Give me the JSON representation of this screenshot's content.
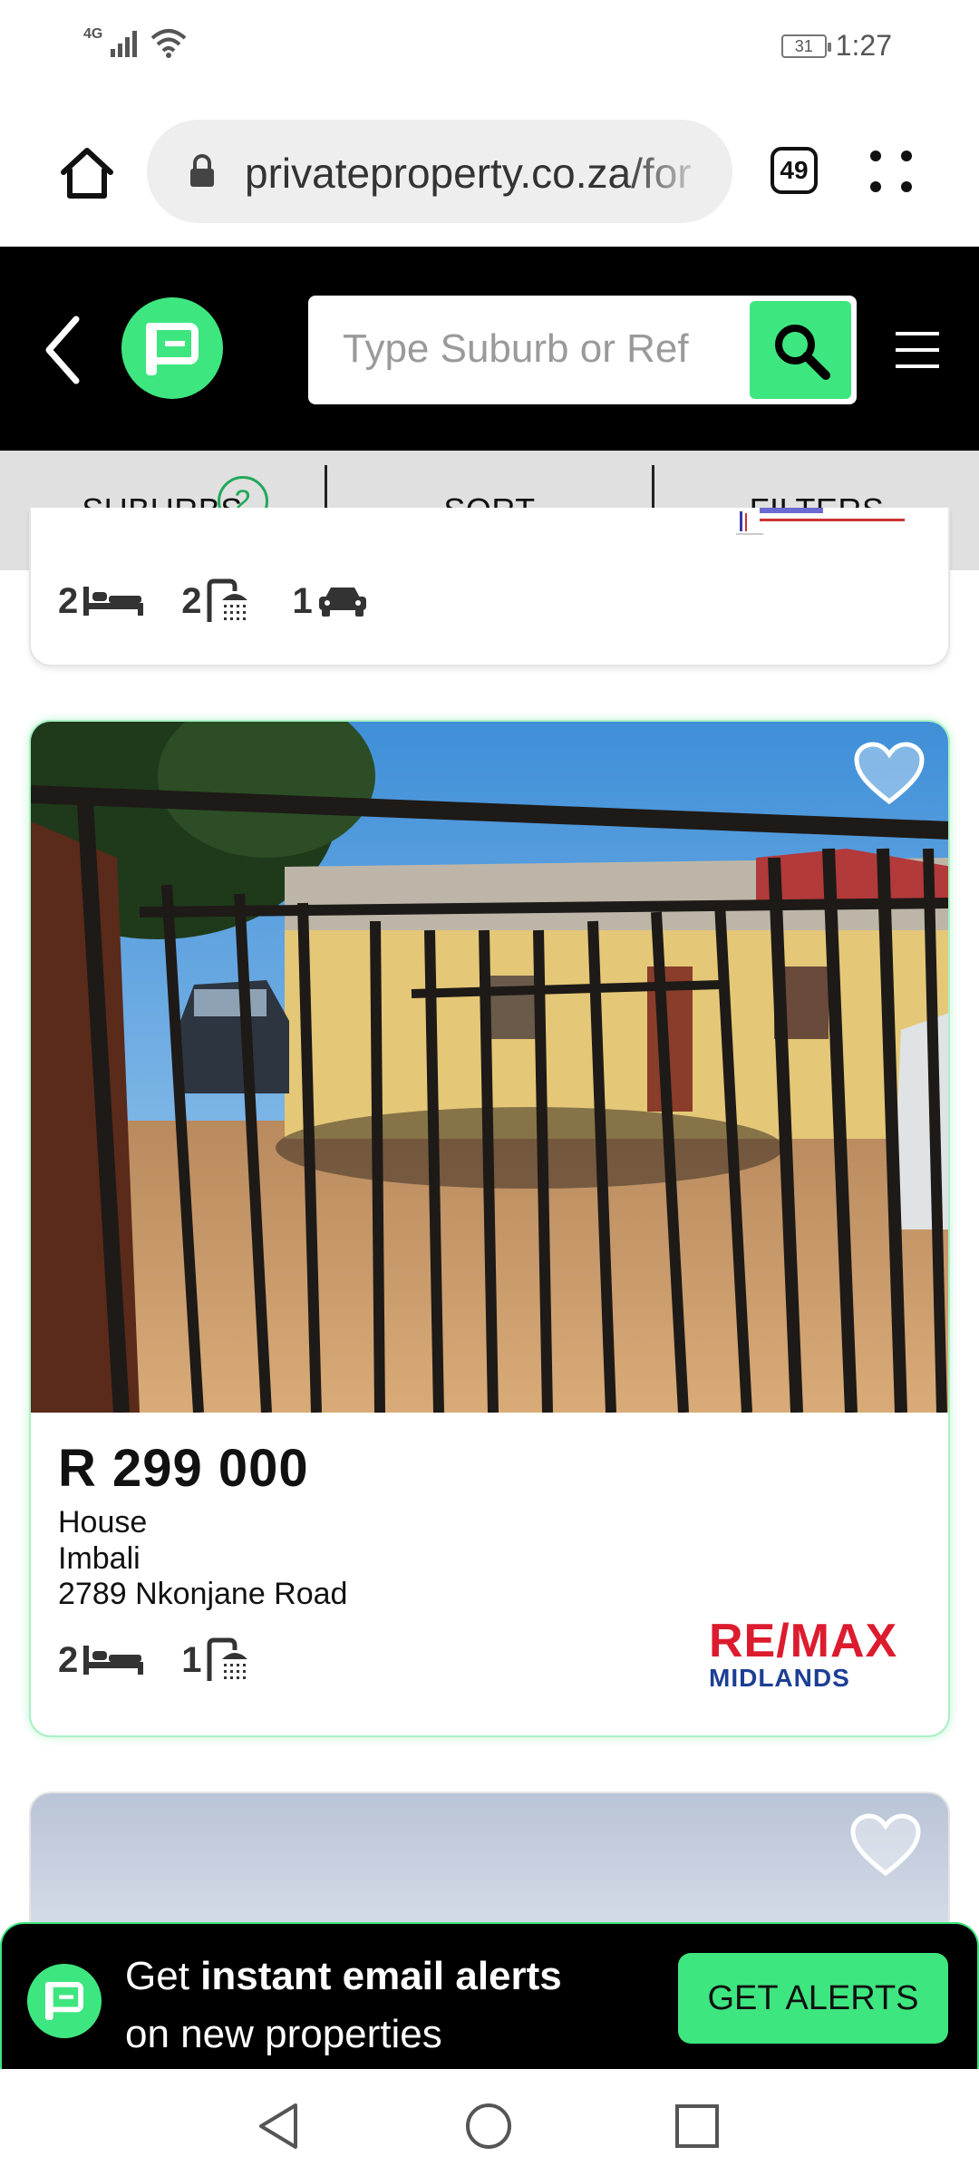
{
  "status_bar": {
    "network": "4G",
    "battery": "31",
    "time": "1:27"
  },
  "browser": {
    "url": "privateproperty.co.za/for",
    "tab_count": "49"
  },
  "header": {
    "search_placeholder": "Type Suburb or Ref"
  },
  "filter_bar": {
    "suburbs_label": "SUBURBS",
    "suburbs_count": "2",
    "sort_label": "SORT",
    "filters_label": "FILTERS"
  },
  "previous_listing": {
    "bedrooms": "2",
    "bathrooms": "2",
    "parking": "1"
  },
  "listing": {
    "price": "R 299 000",
    "type": "House",
    "suburb": "Imbali",
    "address": "2789 Nkonjane Road",
    "bedrooms": "2",
    "bathrooms": "1",
    "agency_name_line1": "RE/MAX",
    "agency_name_line2": "MIDLANDS"
  },
  "alert_banner": {
    "text_prefix": "Get ",
    "text_bold": "instant email alerts",
    "text_line2": "on new properties",
    "button_label": "GET ALERTS"
  },
  "colors": {
    "brand_green": "#3ee67f",
    "header_bg": "#000000",
    "filter_bg": "#e0e0e0",
    "remax_red": "#dc1c2e",
    "remax_blue": "#1c3f94"
  }
}
